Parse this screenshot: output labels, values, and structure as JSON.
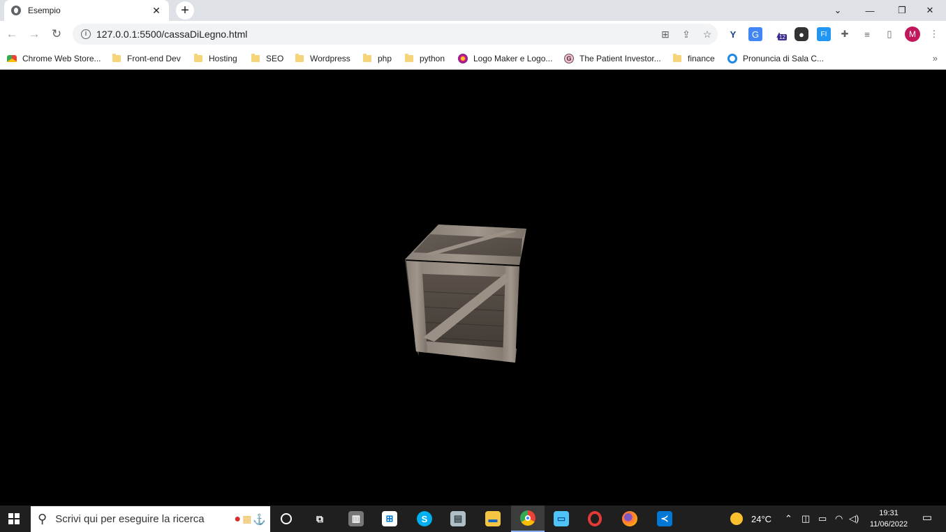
{
  "browser": {
    "tab_title": "Esempio",
    "tab_close": "✕",
    "new_tab": "+",
    "url": "127.0.0.1:5500/cassaDiLegno.html",
    "avatar_letter": "M",
    "extension_badge": "12"
  },
  "bookmarks": [
    {
      "label": "Chrome Web Store...",
      "icon": "chrome-web-store-icon"
    },
    {
      "label": "Front-end Dev",
      "icon": "folder-icon"
    },
    {
      "label": "Hosting",
      "icon": "folder-icon"
    },
    {
      "label": "SEO",
      "icon": "folder-icon"
    },
    {
      "label": "Wordpress",
      "icon": "folder-icon"
    },
    {
      "label": "php",
      "icon": "folder-icon"
    },
    {
      "label": "python",
      "icon": "folder-icon"
    },
    {
      "label": "Logo Maker e Logo...",
      "icon": "logo-maker-icon"
    },
    {
      "label": "The Patient Investor...",
      "icon": "g-icon"
    },
    {
      "label": "finance",
      "icon": "folder-icon"
    },
    {
      "label": "Pronuncia di Sala C...",
      "icon": "circle-icon"
    }
  ],
  "taskbar": {
    "search_placeholder": "Scrivi qui per eseguire la ricerca",
    "weather": "24°C",
    "time": "19:31",
    "date": "11/06/2022"
  }
}
